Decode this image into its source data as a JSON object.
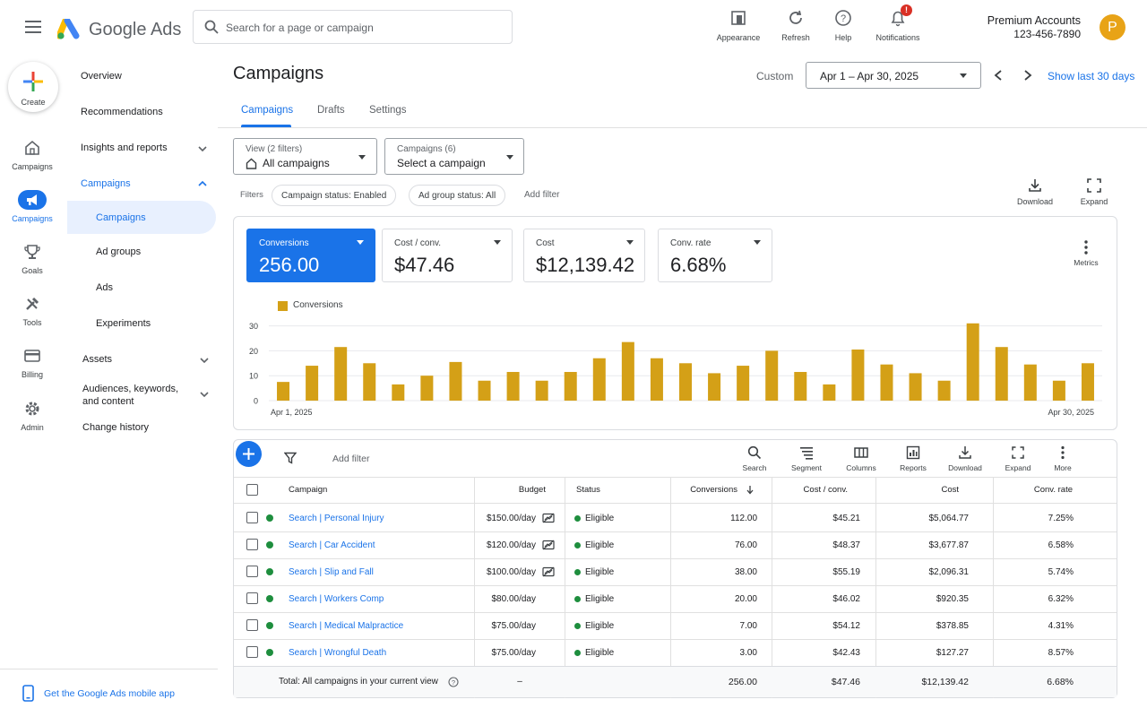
{
  "app": {
    "name": "Google Ads"
  },
  "search": {
    "placeholder": "Search for a page or campaign"
  },
  "toolbar": [
    {
      "label": "Appearance",
      "icon": "appearance-icon"
    },
    {
      "label": "Refresh",
      "icon": "refresh-icon"
    },
    {
      "label": "Help",
      "icon": "help-icon"
    },
    {
      "label": "Notifications",
      "icon": "bell-icon",
      "badge": "!"
    }
  ],
  "account": {
    "name": "Premium Accounts",
    "id": "123-456-7890",
    "initial": "P"
  },
  "rail": {
    "create": "Create",
    "items": [
      "Campaigns",
      "Campaigns",
      "Goals",
      "Tools",
      "Billing",
      "Admin"
    ]
  },
  "nav": {
    "items": [
      "Overview",
      "Recommendations",
      "Insights and reports",
      "Campaigns",
      "Campaigns",
      "Ad groups",
      "Ads",
      "Experiments",
      "Assets",
      "Audiences, keywords, and content",
      "Change history"
    ],
    "mobile_app": "Get the Google Ads mobile app"
  },
  "page": {
    "title": "Campaigns",
    "range_label": "Custom",
    "date_range": "Apr 1 – Apr 30, 2025",
    "show_last": "Show last 30 days",
    "tabs": [
      "Campaigns",
      "Drafts",
      "Settings"
    ]
  },
  "selectors": {
    "view": {
      "small": "View (2 filters)",
      "big": "All campaigns"
    },
    "campaigns": {
      "small": "Campaigns (6)",
      "big": "Select a campaign"
    }
  },
  "filters": {
    "label": "Filters",
    "chips": [
      "Campaign status: Enabled",
      "Ad group status: All"
    ],
    "add": "Add filter"
  },
  "top_tools": [
    "Download",
    "Expand"
  ],
  "metrics": [
    {
      "label": "Conversions",
      "value": "256.00",
      "selected": true
    },
    {
      "label": "Cost / conv.",
      "value": "$47.46",
      "selected": false
    },
    {
      "label": "Cost",
      "value": "$12,139.42",
      "selected": false
    },
    {
      "label": "Conv. rate",
      "value": "6.68%",
      "selected": false
    }
  ],
  "metrics_button": "Metrics",
  "chart_data": {
    "type": "bar",
    "series": [
      {
        "name": "Conversions",
        "values": [
          7.5,
          14,
          21.5,
          15,
          6.5,
          10,
          15.5,
          8,
          11.5,
          8,
          11.5,
          17,
          23.5,
          17,
          15,
          11,
          14,
          20,
          11.5,
          6.5,
          20.5,
          14.5,
          11,
          8,
          31,
          21.5,
          14.5,
          8,
          15
        ]
      }
    ],
    "x_labels": [
      "Apr 1, 2025",
      "Apr 30, 2025"
    ],
    "yticks": [
      0,
      10,
      20,
      30
    ],
    "ylim": [
      0,
      32
    ],
    "color": "#d4a017",
    "grid": true,
    "legend": "top-left"
  },
  "table": {
    "add_filter": "Add filter",
    "tools": [
      {
        "label": "Search",
        "icon": "search-icon"
      },
      {
        "label": "Segment",
        "icon": "segment-icon"
      },
      {
        "label": "Columns",
        "icon": "columns-icon"
      },
      {
        "label": "Reports",
        "icon": "reports-icon"
      },
      {
        "label": "Download",
        "icon": "download-icon"
      },
      {
        "label": "Expand",
        "icon": "expand-icon"
      },
      {
        "label": "More",
        "icon": "more-icon"
      }
    ],
    "headers": [
      "Campaign",
      "Budget",
      "Status",
      "Conversions",
      "Cost / conv.",
      "Cost",
      "Conv. rate"
    ],
    "rows": [
      {
        "campaign": "Search | Personal Injury",
        "budget": "$150.00/day",
        "limited": true,
        "status": "Eligible",
        "conversions": "112.00",
        "cost_conv": "$45.21",
        "cost": "$5,064.77",
        "conv_rate": "7.25%"
      },
      {
        "campaign": "Search | Car Accident",
        "budget": "$120.00/day",
        "limited": true,
        "status": "Eligible",
        "conversions": "76.00",
        "cost_conv": "$48.37",
        "cost": "$3,677.87",
        "conv_rate": "6.58%"
      },
      {
        "campaign": "Search | Slip and Fall",
        "budget": "$100.00/day",
        "limited": true,
        "status": "Eligible",
        "conversions": "38.00",
        "cost_conv": "$55.19",
        "cost": "$2,096.31",
        "conv_rate": "5.74%"
      },
      {
        "campaign": "Search | Workers Comp",
        "budget": "$80.00/day",
        "limited": false,
        "status": "Eligible",
        "conversions": "20.00",
        "cost_conv": "$46.02",
        "cost": "$920.35",
        "conv_rate": "6.32%"
      },
      {
        "campaign": "Search | Medical Malpractice",
        "budget": "$75.00/day",
        "limited": false,
        "status": "Eligible",
        "conversions": "7.00",
        "cost_conv": "$54.12",
        "cost": "$378.85",
        "conv_rate": "4.31%"
      },
      {
        "campaign": "Search | Wrongful Death",
        "budget": "$75.00/day",
        "limited": false,
        "status": "Eligible",
        "conversions": "3.00",
        "cost_conv": "$42.43",
        "cost": "$127.27",
        "conv_rate": "8.57%"
      }
    ],
    "total": {
      "label": "Total: All campaigns in your current view",
      "budget": "–",
      "conversions": "256.00",
      "cost_conv": "$47.46",
      "cost": "$12,139.42",
      "conv_rate": "6.68%"
    }
  },
  "colors": {
    "accent": "#1a73e8",
    "bar": "#d4a017",
    "status": "#1e8e3e",
    "avatar": "#e8a317"
  }
}
